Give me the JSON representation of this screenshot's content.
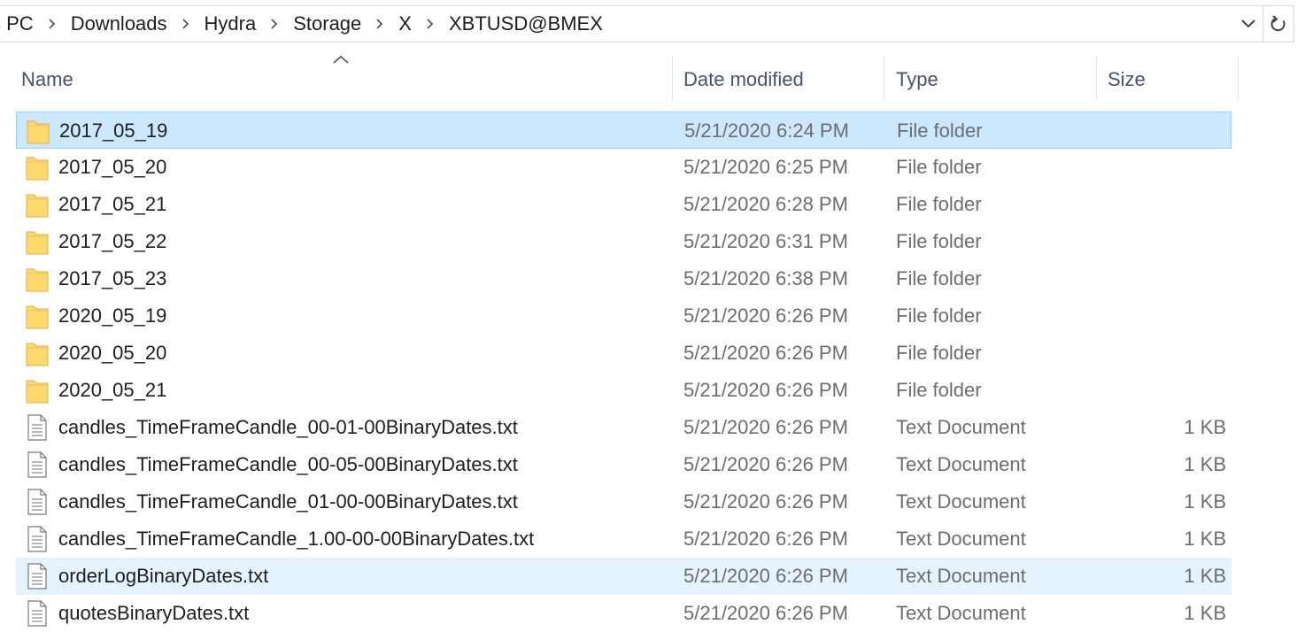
{
  "breadcrumb": [
    "s PC",
    "Downloads",
    "Hydra",
    "Storage",
    "X",
    "XBTUSD@BMEX"
  ],
  "columns": {
    "name": "Name",
    "date": "Date modified",
    "type": "Type",
    "size": "Size"
  },
  "files": [
    {
      "name": "2017_05_19",
      "date": "5/21/2020 6:24 PM",
      "type": "File folder",
      "size": "",
      "kind": "folder",
      "state": "selected"
    },
    {
      "name": "2017_05_20",
      "date": "5/21/2020 6:25 PM",
      "type": "File folder",
      "size": "",
      "kind": "folder"
    },
    {
      "name": "2017_05_21",
      "date": "5/21/2020 6:28 PM",
      "type": "File folder",
      "size": "",
      "kind": "folder"
    },
    {
      "name": "2017_05_22",
      "date": "5/21/2020 6:31 PM",
      "type": "File folder",
      "size": "",
      "kind": "folder"
    },
    {
      "name": "2017_05_23",
      "date": "5/21/2020 6:38 PM",
      "type": "File folder",
      "size": "",
      "kind": "folder"
    },
    {
      "name": "2020_05_19",
      "date": "5/21/2020 6:26 PM",
      "type": "File folder",
      "size": "",
      "kind": "folder"
    },
    {
      "name": "2020_05_20",
      "date": "5/21/2020 6:26 PM",
      "type": "File folder",
      "size": "",
      "kind": "folder"
    },
    {
      "name": "2020_05_21",
      "date": "5/21/2020 6:26 PM",
      "type": "File folder",
      "size": "",
      "kind": "folder"
    },
    {
      "name": "candles_TimeFrameCandle_00-01-00BinaryDates.txt",
      "date": "5/21/2020 6:26 PM",
      "type": "Text Document",
      "size": "1 KB",
      "kind": "text"
    },
    {
      "name": "candles_TimeFrameCandle_00-05-00BinaryDates.txt",
      "date": "5/21/2020 6:26 PM",
      "type": "Text Document",
      "size": "1 KB",
      "kind": "text"
    },
    {
      "name": "candles_TimeFrameCandle_01-00-00BinaryDates.txt",
      "date": "5/21/2020 6:26 PM",
      "type": "Text Document",
      "size": "1 KB",
      "kind": "text"
    },
    {
      "name": "candles_TimeFrameCandle_1.00-00-00BinaryDates.txt",
      "date": "5/21/2020 6:26 PM",
      "type": "Text Document",
      "size": "1 KB",
      "kind": "text"
    },
    {
      "name": "orderLogBinaryDates.txt",
      "date": "5/21/2020 6:26 PM",
      "type": "Text Document",
      "size": "1 KB",
      "kind": "text",
      "state": "hover"
    },
    {
      "name": "quotesBinaryDates.txt",
      "date": "5/21/2020 6:26 PM",
      "type": "Text Document",
      "size": "1 KB",
      "kind": "text"
    }
  ],
  "icons": {
    "folder": "folder-icon",
    "text": "text-document-icon",
    "separator": "chevron-right-icon",
    "dropdown": "chevron-down-icon",
    "refresh": "refresh-icon",
    "sort": "sort-ascending-icon"
  },
  "colors": {
    "selected_bg": "#cce8ff",
    "selected_border": "#99d1ff",
    "hover_bg": "#e5f3ff",
    "folder": "#ffd96b",
    "header_text": "#44546a",
    "secondary_text": "#6d6d6d"
  }
}
